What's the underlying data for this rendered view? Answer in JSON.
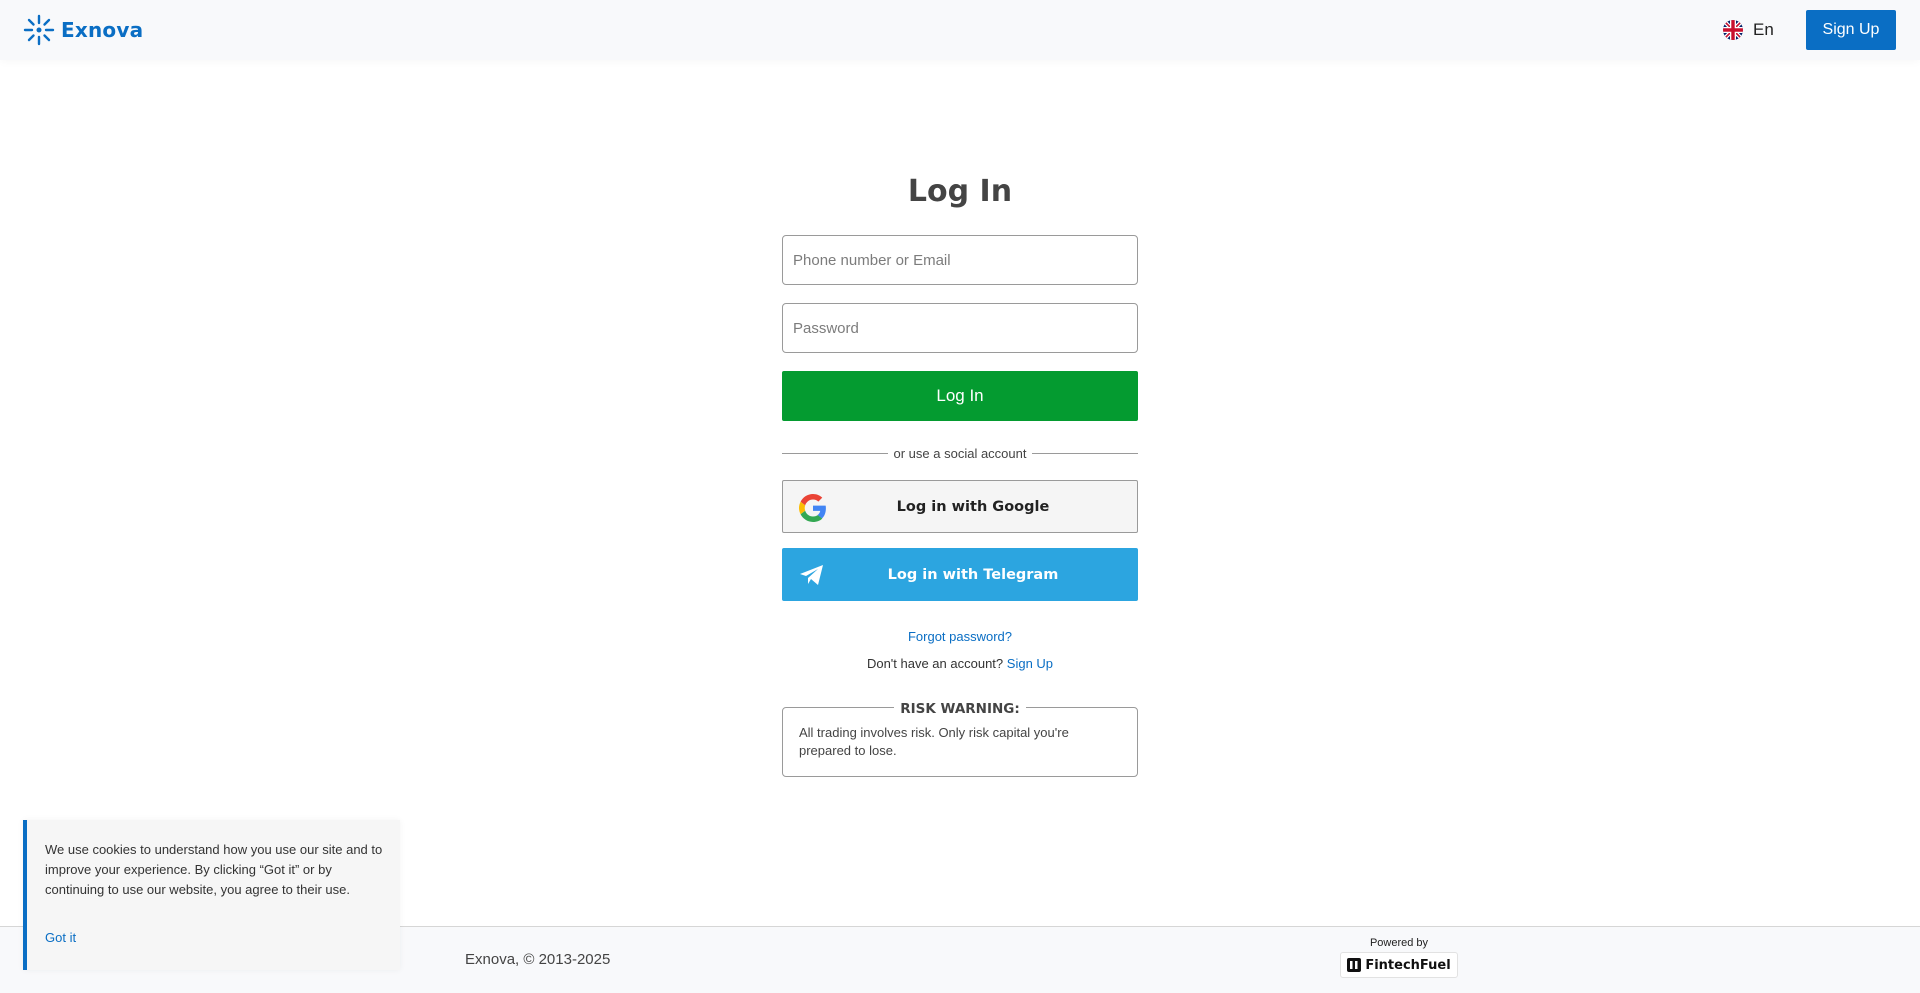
{
  "header": {
    "brand_name": "Exnova",
    "logo_icon": "sun-burst-icon",
    "language": {
      "flag_icon": "uk-flag-icon",
      "label": "En"
    },
    "signup_label": "Sign Up"
  },
  "login": {
    "title": "Log In",
    "email_placeholder": "Phone number or Email",
    "password_placeholder": "Password",
    "submit_label": "Log In",
    "divider_text": "or use a social account",
    "google_label": "Log in with Google",
    "google_icon": "google-icon",
    "telegram_label": "Log in with Telegram",
    "telegram_icon": "telegram-icon",
    "forgot_label": "Forgot password?",
    "no_account_text": "Don't have an account?",
    "no_account_link": "Sign Up"
  },
  "risk": {
    "title": "RISK WARNING:",
    "text": "All trading involves risk. Only risk capital you're prepared to lose."
  },
  "footer": {
    "copyright": "Exnova, © 2013-2025",
    "powered_label": "Powered by",
    "powered_name": "FintechFuel",
    "powered_icon": "fintechfuel-icon"
  },
  "cookie": {
    "text": "We use cookies to understand how you use our site and to improve your experience. By clicking “Got it” or by continuing to use our website, you agree to their use.",
    "button_label": "Got it"
  },
  "colors": {
    "brand_blue": "#0a6ec4",
    "login_green": "#049b30",
    "telegram_blue": "#2ca5e0",
    "header_bg": "#f8f9fb"
  }
}
